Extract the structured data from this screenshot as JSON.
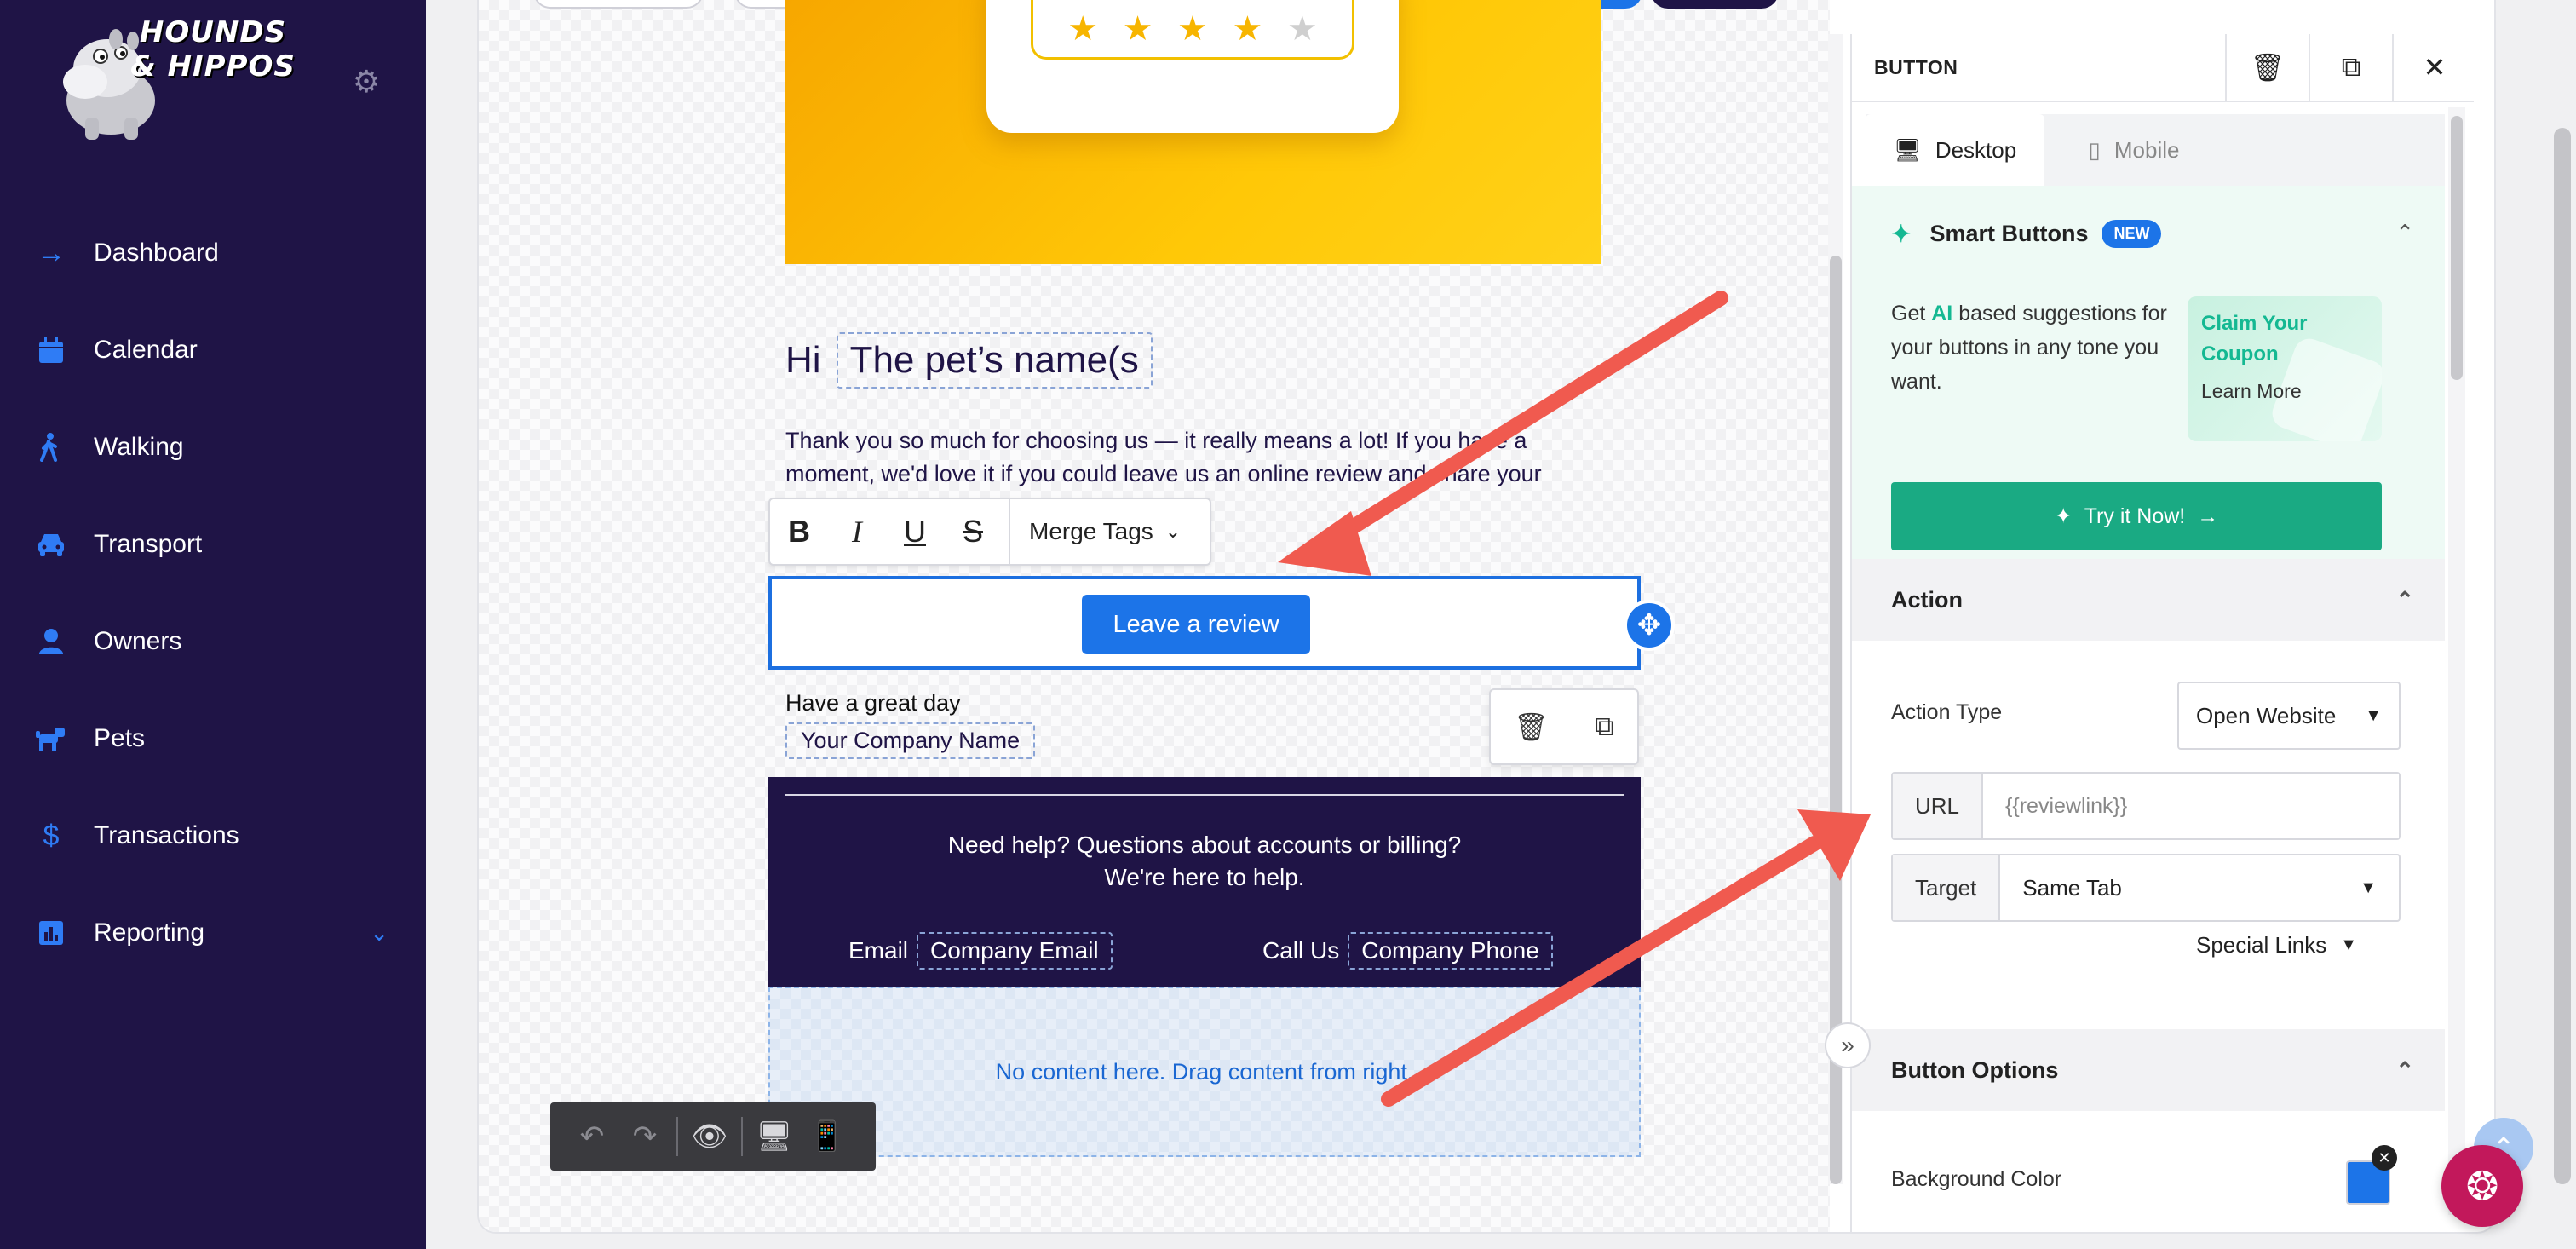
{
  "brand": {
    "name": "HOUNDS & HIPPOS"
  },
  "sidebar": {
    "items": [
      {
        "label": "Dashboard",
        "icon": "arrow-right-icon"
      },
      {
        "label": "Calendar",
        "icon": "calendar-icon"
      },
      {
        "label": "Walking",
        "icon": "walking-icon"
      },
      {
        "label": "Transport",
        "icon": "car-icon"
      },
      {
        "label": "Owners",
        "icon": "user-icon"
      },
      {
        "label": "Pets",
        "icon": "dog-icon"
      },
      {
        "label": "Transactions",
        "icon": "dollar-icon"
      },
      {
        "label": "Reporting",
        "icon": "chart-icon"
      }
    ]
  },
  "email": {
    "greeting": "Hi",
    "pet_tag": "The pet’s name(s",
    "body": "Thank you so much for choosing us — it really means a lot! If you have a moment, we'd love it if you could leave us an online review and share your",
    "merge_tags_label": "Merge Tags",
    "button_label": "Leave a review",
    "signoff": "Have a great day",
    "company_tag": "Your Company Name",
    "footer_line1": "Need help? Questions about accounts or billing?",
    "footer_line2": "We're here to help.",
    "email_label": "Email",
    "email_tag": "Company Email",
    "call_label": "Call Us",
    "phone_tag": "Company Phone",
    "dropzone": "No content here. Drag content from right.",
    "stars_filled": 4,
    "stars_total": 5
  },
  "panel": {
    "title": "BUTTON",
    "tabs": {
      "desktop": "Desktop",
      "mobile": "Mobile"
    },
    "smart": {
      "title": "Smart Buttons",
      "badge": "NEW",
      "text_before": "Get ",
      "text_ai": "AI",
      "text_after": " based suggestions for your buttons in any tone you want.",
      "coupon_title": "Claim Your Coupon",
      "coupon_link": "Learn More",
      "try_label": "Try it Now!"
    },
    "action": {
      "header": "Action",
      "type_label": "Action Type",
      "type_value": "Open Website",
      "url_label": "URL",
      "url_placeholder": "{{reviewlink}}",
      "target_label": "Target",
      "target_value": "Same Tab",
      "special_links": "Special Links"
    },
    "button_options": {
      "header": "Button Options",
      "bg_label": "Background Color",
      "bg_color": "#1c74e8"
    }
  },
  "colors": {
    "sidebar_bg": "#1f1446",
    "accent": "#1c74e8",
    "smart_green": "#1aaa83",
    "arrow": "#f05a4f"
  }
}
